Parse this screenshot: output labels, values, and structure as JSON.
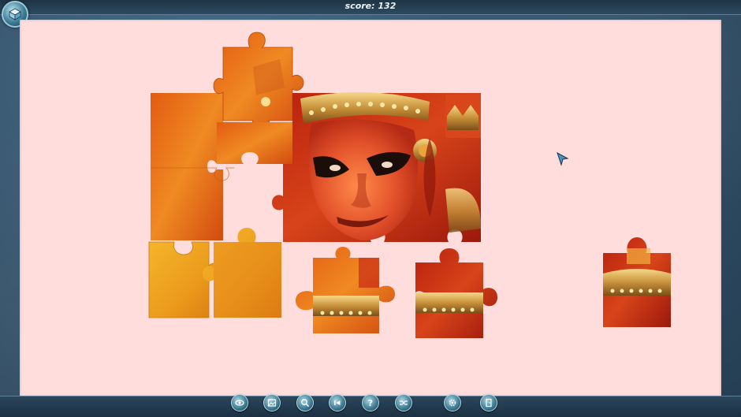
{
  "header": {
    "score_label": "score:",
    "score_value": "132"
  },
  "toolbar": {
    "buttons": [
      {
        "name": "preview-icon"
      },
      {
        "name": "background-icon"
      },
      {
        "name": "magnify-icon"
      },
      {
        "name": "back-arrow-icon"
      },
      {
        "name": "help-icon",
        "glyph": "?"
      },
      {
        "name": "shuffle-icon"
      },
      {
        "name": "settings-gear-icon"
      },
      {
        "name": "exit-door-icon"
      }
    ]
  },
  "colors": {
    "board": "#fedddc",
    "frame": "#34536b",
    "piece_orange": "#e8701c",
    "piece_red": "#c92a14",
    "piece_yellow": "#f0a520"
  }
}
